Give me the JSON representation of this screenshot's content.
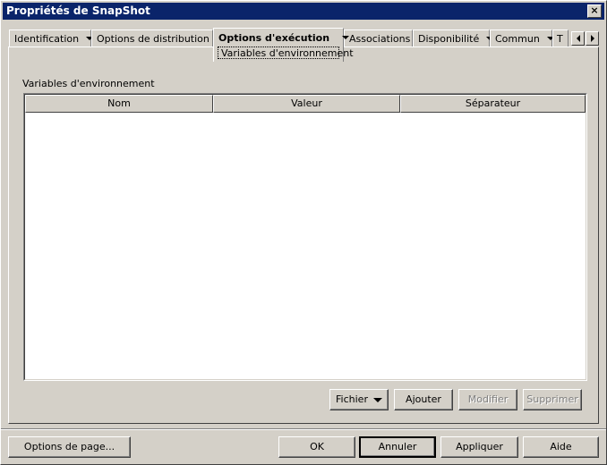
{
  "window": {
    "title": "Propriétés de SnapShot",
    "close_glyph": "×"
  },
  "tabs": [
    {
      "label": "Identification"
    },
    {
      "label": "Options de distribution"
    },
    {
      "label": "Options d'exécution",
      "subtab": "Variables d'environnement"
    },
    {
      "label": "Associations"
    },
    {
      "label": "Disponibilité"
    },
    {
      "label": "Commun"
    },
    {
      "label": "T"
    }
  ],
  "panel": {
    "section_label": "Variables d'environnement",
    "columns": [
      "Nom",
      "Valeur",
      "Séparateur"
    ],
    "rows": [],
    "buttons": {
      "fichier": "Fichier",
      "ajouter": "Ajouter",
      "modifier": "Modifier",
      "supprimer": "Supprimer"
    }
  },
  "footer": {
    "options_page": "Options de page...",
    "ok": "OK",
    "annuler": "Annuler",
    "appliquer": "Appliquer",
    "aide": "Aide"
  },
  "colors": {
    "titlebar": "#0a246a",
    "face": "#d4d0c8"
  }
}
